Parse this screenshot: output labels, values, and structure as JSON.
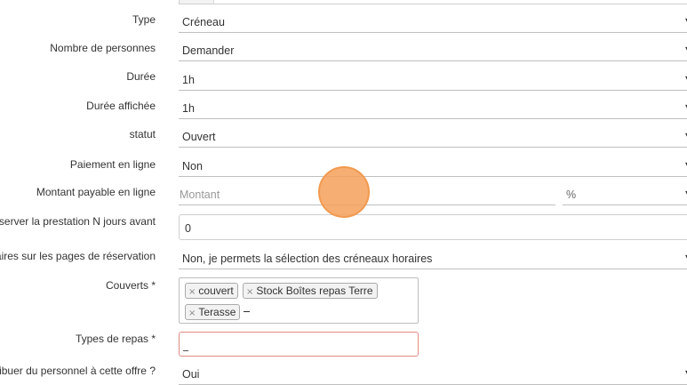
{
  "fields": {
    "type": {
      "label": "Type",
      "value": "Créneau"
    },
    "people": {
      "label": "Nombre de personnes",
      "value": "Demander"
    },
    "duration": {
      "label": "Durée",
      "value": "1h"
    },
    "displayed_duration": {
      "label": "Durée affichée",
      "value": "1h"
    },
    "status": {
      "label": "statut",
      "value": "Ouvert"
    },
    "online_payment": {
      "label": "Paiement en ligne",
      "value": "Non"
    },
    "amount": {
      "label": "Montant payable en ligne",
      "placeholder": "Montant",
      "unit": "%"
    },
    "reserve_days": {
      "label": "éserver la prestation N jours avant",
      "value": "0"
    },
    "time_slots": {
      "label": "aires sur les pages de réservation",
      "value": "Non, je permets la sélection des créneaux horaires"
    },
    "covers": {
      "label": "Couverts *",
      "tags": [
        "couvert",
        "Stock Boîtes repas Terre",
        "Terasse"
      ]
    },
    "meal_types": {
      "label": "Types de repas *"
    },
    "staff": {
      "label": "ribuer du personnel à cette offre ?",
      "value": "Oui"
    }
  },
  "icons": {
    "chevron": "chevron-down-icon",
    "remove": "remove-tag-icon",
    "click_indicator": "#f5a05a"
  }
}
